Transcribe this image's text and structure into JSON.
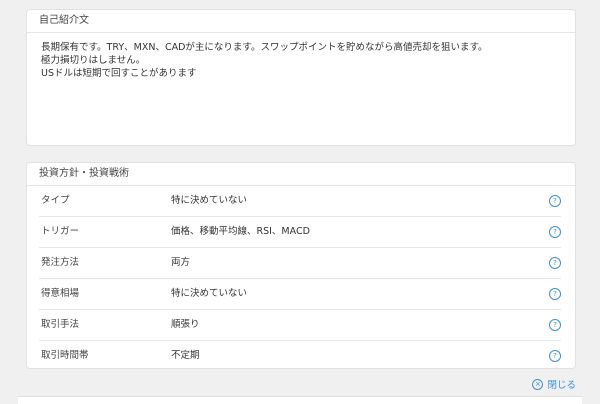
{
  "intro": {
    "title": "自己紹介文",
    "lines": [
      "長期保有です。TRY、MXN、CADが主になります。スワップポイントを貯めながら高値売却を狙います。",
      "極力損切りはしません。",
      "USドルは短期で回すことがあります"
    ]
  },
  "strategy": {
    "title": "投資方針・投資戦術",
    "rows": [
      {
        "label": "タイプ",
        "value": "特に決めていない"
      },
      {
        "label": "トリガー",
        "value": "価格、移動平均線、RSI、MACD"
      },
      {
        "label": "発注方法",
        "value": "両方"
      },
      {
        "label": "得意相場",
        "value": "特に決めていない"
      },
      {
        "label": "取引手法",
        "value": "順張り"
      },
      {
        "label": "取引時間帯",
        "value": "不定期"
      }
    ],
    "help_icon": "?"
  },
  "close": {
    "label": "閉じる",
    "icon": "×"
  },
  "colors": {
    "accent": "#3d8fd6",
    "background": "#f0f0f0"
  }
}
